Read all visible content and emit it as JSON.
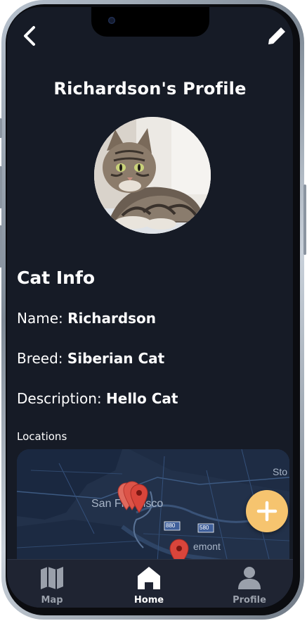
{
  "profile": {
    "title": "Richardson's Profile",
    "section_title": "Cat Info",
    "name_label": "Name:",
    "name_value": "Richardson",
    "breed_label": "Breed:",
    "breed_value": "Siberian Cat",
    "description_label": "Description:",
    "description_value": "Hello Cat",
    "locations_label": "Locations"
  },
  "map": {
    "labels": {
      "city": "San Francisco",
      "place_right": "Sto",
      "place_bottom": "emont",
      "highway_1": "880",
      "highway_2": "580"
    }
  },
  "nav": {
    "items": [
      {
        "label": "Map",
        "icon": "map-icon"
      },
      {
        "label": "Home",
        "icon": "home-icon",
        "active": true
      },
      {
        "label": "Profile",
        "icon": "person-icon"
      }
    ]
  },
  "colors": {
    "background": "#161b26",
    "fab": "#f6c46f",
    "marker": "#d9453b",
    "nav_active": "#ffffff",
    "nav_inactive": "#9aa0ab"
  }
}
